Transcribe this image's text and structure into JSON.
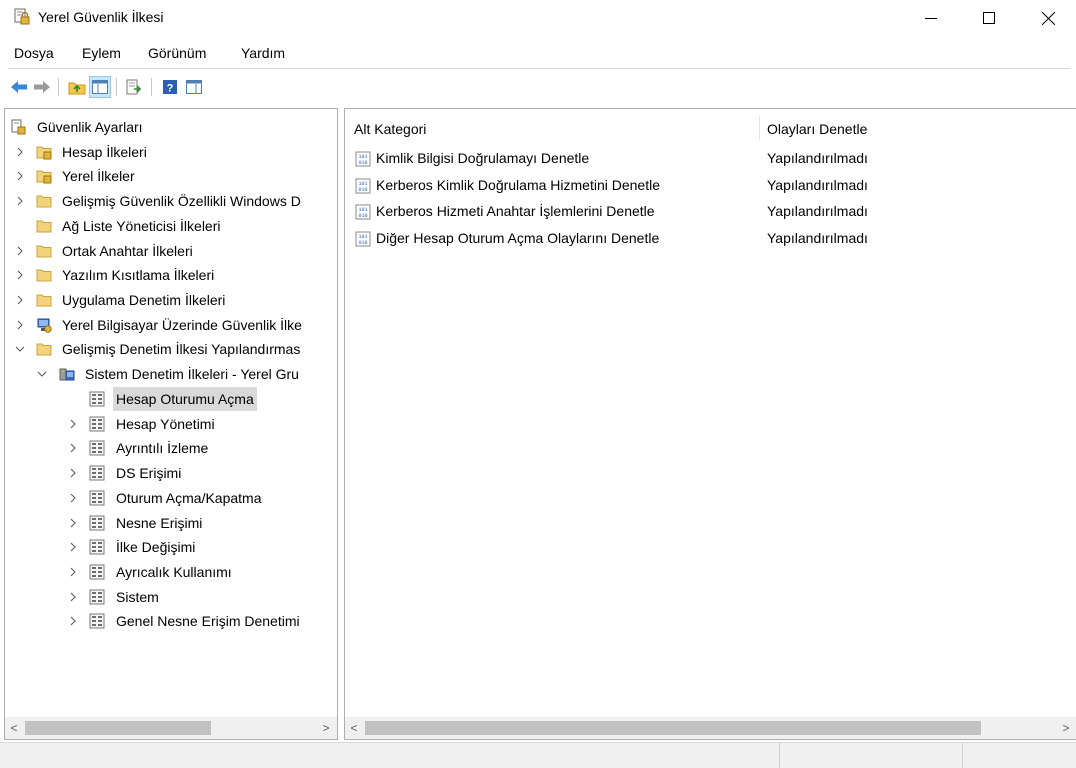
{
  "window": {
    "title": "Yerel Güvenlik İlkesi"
  },
  "menu": [
    "Dosya",
    "Eylem",
    "Görünüm",
    "Yardım"
  ],
  "toolbar": [
    "back-icon",
    "forward-icon",
    "up-folder-icon",
    "show-hide-tree-icon",
    "export-list-icon",
    "help-icon",
    "properties-icon"
  ],
  "tree": {
    "root": "Güvenlik Ayarları",
    "items": [
      "Hesap İlkeleri",
      "Yerel İlkeler",
      "Gelişmiş Güvenlik Özellikli Windows D",
      "Ağ Liste Yöneticisi İlkeleri",
      "Ortak Anahtar İlkeleri",
      "Yazılım Kısıtlama İlkeleri",
      "Uygulama Denetim İlkeleri",
      "Yerel Bilgisayar Üzerinde Güvenlik İlke",
      "Gelişmiş Denetim İlkesi Yapılandırmas",
      "Sistem Denetim İlkeleri - Yerel Gru",
      "Hesap Oturumu Açma",
      "Hesap Yönetimi",
      "Ayrıntılı İzleme",
      "DS Erişimi",
      "Oturum Açma/Kapatma",
      "Nesne Erişimi",
      "İlke Değişimi",
      "Ayrıcalık Kullanımı",
      "Sistem",
      "Genel Nesne Erişim Denetimi"
    ],
    "selected": "Hesap Oturumu Açma"
  },
  "list": {
    "headers": [
      "Alt Kategori",
      "Olayları Denetle"
    ],
    "rows": [
      {
        "name": "Kimlik Bilgisi Doğrulamayı Denetle",
        "status": "Yapılandırılmadı"
      },
      {
        "name": "Kerberos Kimlik Doğrulama Hizmetini Denetle",
        "status": "Yapılandırılmadı"
      },
      {
        "name": "Kerberos Hizmeti Anahtar İşlemlerini Denetle",
        "status": "Yapılandırılmadı"
      },
      {
        "name": "Diğer Hesap Oturum Açma Olaylarını Denetle",
        "status": "Yapılandırılmadı"
      }
    ]
  },
  "colors": {
    "accent": "#1e6fcc",
    "selection": "#d9d9d9",
    "folder": "#f2d27a"
  }
}
